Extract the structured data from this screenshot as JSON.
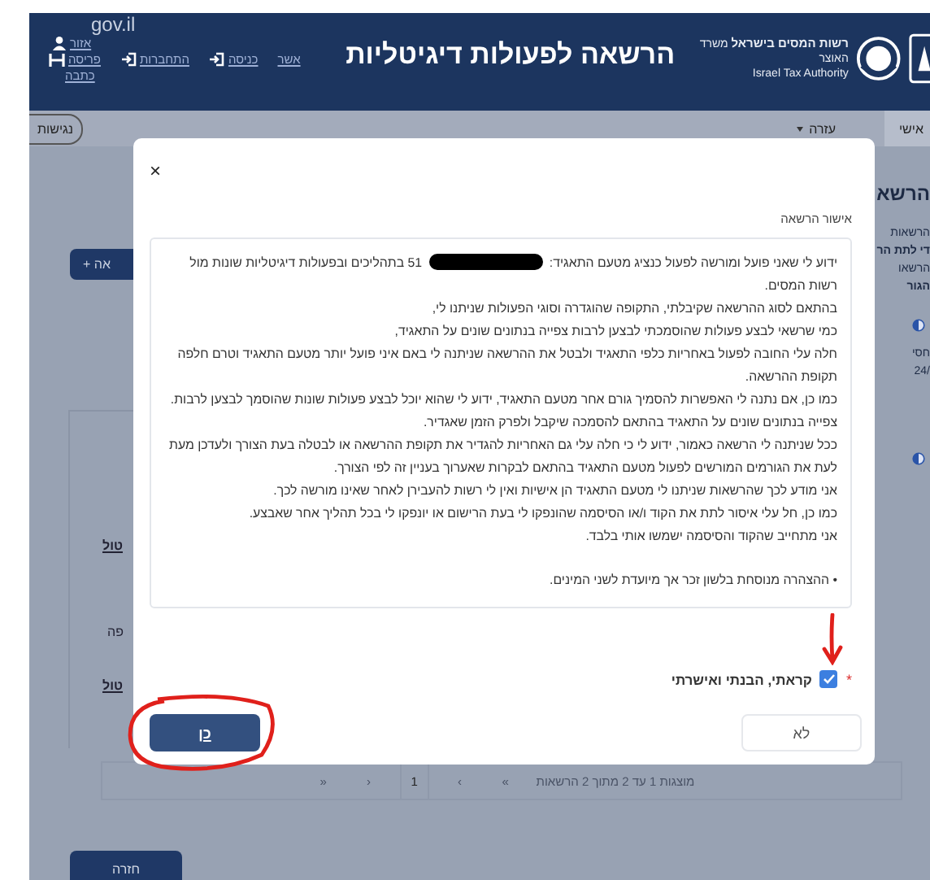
{
  "header": {
    "site": "gov.il",
    "link_rows": [
      [
        {
          "kind": "user",
          "label": "אזור"
        }
      ],
      [
        {
          "kind": "plain",
          "label": "אשר"
        },
        {
          "kind": "enter",
          "label": "כניסה"
        },
        {
          "kind": "login",
          "label": "התחברות"
        },
        {
          "kind": "profile",
          "label": "פריסה"
        }
      ],
      [
        {
          "kind": "plain",
          "label": "כתבה"
        }
      ]
    ],
    "title": "הרשאה לפעולות דיגיטליות",
    "authority_he": "רשות המסים בישראל",
    "ministry_he": "משרד האוצר",
    "authority_en": "Israel Tax Authority"
  },
  "nav": {
    "accessibility": "נגישות",
    "help": "עזרה",
    "personal": "אישי"
  },
  "left": {
    "add_button": "+ אה",
    "items": [
      {
        "kind": "link",
        "text": "טול"
      },
      {
        "kind": "text",
        "text": "פה"
      },
      {
        "kind": "link",
        "text": "טול"
      }
    ]
  },
  "right": {
    "heading": "הרשא",
    "items": [
      {
        "kind": "text",
        "text": "הרשאות"
      },
      {
        "kind": "bold",
        "text": "די לתת הר"
      },
      {
        "kind": "tab",
        "text": "הרשאו"
      },
      {
        "kind": "header",
        "text": "הגור"
      },
      {
        "kind": "icon"
      },
      {
        "kind": "text",
        "text": "חסי"
      },
      {
        "kind": "text",
        "text": "/24"
      },
      {
        "kind": "icon"
      }
    ]
  },
  "dialog": {
    "close": "×",
    "title": "אישור הרשאה",
    "paragraphs": [
      [
        {
          "kind": "text",
          "text": "ידוע לי שאני פועל ומורשה לפעול כנציג מטעם התאגיד:"
        },
        {
          "kind": "redaction"
        },
        {
          "kind": "text",
          "text": "51 בתהליכים ובפעולות דיגיטליות שונות מול רשות המסים."
        }
      ],
      [
        {
          "kind": "text",
          "text": "בהתאם לסוג ההרשאה שקיבלתי, התקופה שהוגדרה וסוגי הפעולות שניתנו לי,"
        }
      ],
      [
        {
          "kind": "text",
          "text": "כמי שרשאי לבצע פעולות שהוסמכתי לבצען לרבות צפייה בנתונים שונים על התאגיד,"
        }
      ],
      [
        {
          "kind": "text",
          "text": "חלה עלי החובה לפעול באחריות כלפי התאגיד ולבטל את ההרשאה שניתנה לי באם איני פועל יותר מטעם התאגיד וטרם חלפה תקופת ההרשאה."
        }
      ],
      [
        {
          "kind": "text",
          "text": "כמו כן, אם נתנה לי האפשרות להסמיך גורם אחר מטעם התאגיד, ידוע לי שהוא יוכל לבצע פעולות שונות שהוסמך לבצען לרבות."
        }
      ],
      [
        {
          "kind": "text",
          "text": "צפייה בנתונים שונים על התאגיד בהתאם להסמכה שיקבל ולפרק הזמן שאגדיר."
        }
      ],
      [
        {
          "kind": "text",
          "text": "ככל שניתנה לי הרשאה כאמור, ידוע לי כי חלה עלי גם האחריות להגדיר את תקופת ההרשאה או לבטלה בעת הצורך ולעדכן מעת לעת את הגורמים המורשים לפעול מטעם התאגיד בהתאם לבקרות שאערוך בעניין זה לפי הצורך."
        }
      ],
      [
        {
          "kind": "text",
          "text": "אני מודע לכך שהרשאות שניתנו לי מטעם התאגיד הן אישיות ואין לי רשות להעבירן לאחר שאינו מורשה לכך."
        }
      ],
      [
        {
          "kind": "text",
          "text": "כמו כן, חל עלי איסור לתת את הקוד ו/או הסיסמה שהונפקו לי בעת הרישום או יונפקו לי בכל תהליך אחר שאבצע."
        }
      ],
      [
        {
          "kind": "text",
          "text": "אני מתחייב שהקוד והסיסמה ישמשו אותי בלבד."
        }
      ]
    ],
    "note": "• ההצהרה מנוסחת בלשון זכר אך מיועדת לשני המינים.",
    "consent": {
      "label": "קראתי, הבנתי ואישרתי",
      "required_mark": "*",
      "checked": true
    },
    "buttons": [
      {
        "kind": "secondary",
        "label": "לא"
      },
      {
        "kind": "primary",
        "label": "כן"
      }
    ]
  },
  "pagination": {
    "summary": "מוצגות 1 עד 2 מתוך 2 הרשאות",
    "controls": [
      {
        "label": "»",
        "selected": false
      },
      {
        "label": "›",
        "selected": false
      },
      {
        "label": "1",
        "selected": true
      },
      {
        "label": "‹",
        "selected": false
      },
      {
        "label": "«",
        "selected": false
      }
    ]
  },
  "back_button": "חזרה",
  "annotations": [
    {
      "kind": "arrow"
    },
    {
      "kind": "ellipse"
    }
  ]
}
